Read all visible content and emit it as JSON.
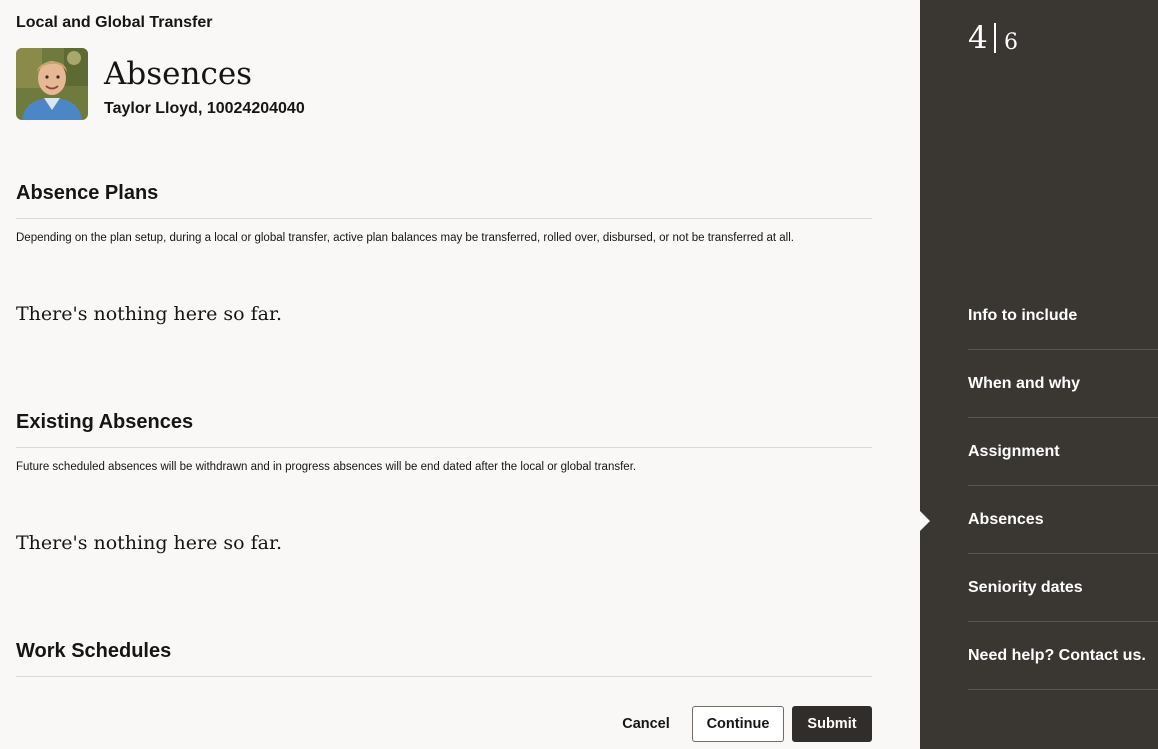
{
  "header": {
    "app_title": "Local and Global Transfer",
    "page_title": "Absences",
    "person": "Taylor Lloyd, 10024204040"
  },
  "sections": [
    {
      "title": "Absence Plans",
      "description": "Depending on the plan setup, during a local or global transfer, active plan balances may be transferred, rolled over, disbursed, or not be transferred at all.",
      "empty_text": "There's nothing here so far."
    },
    {
      "title": "Existing Absences",
      "description": "Future scheduled absences will be withdrawn and in progress absences will be end dated after the local or global transfer.",
      "empty_text": "There's nothing here so far."
    },
    {
      "title": "Work Schedules"
    }
  ],
  "footer": {
    "cancel_label": "Cancel",
    "continue_label": "Continue",
    "submit_label": "Submit"
  },
  "progress": {
    "current": "4",
    "total": "6"
  },
  "nav": {
    "items": [
      {
        "label": "Info to include"
      },
      {
        "label": "When and why"
      },
      {
        "label": "Assignment"
      },
      {
        "label": "Absences"
      },
      {
        "label": "Seniority dates"
      },
      {
        "label": "Need help? Contact us."
      }
    ],
    "active_index": 3
  },
  "colors": {
    "sidebar_bg": "#3a3632",
    "page_bg": "#f9f8f6",
    "primary_button": "#312d2a"
  }
}
